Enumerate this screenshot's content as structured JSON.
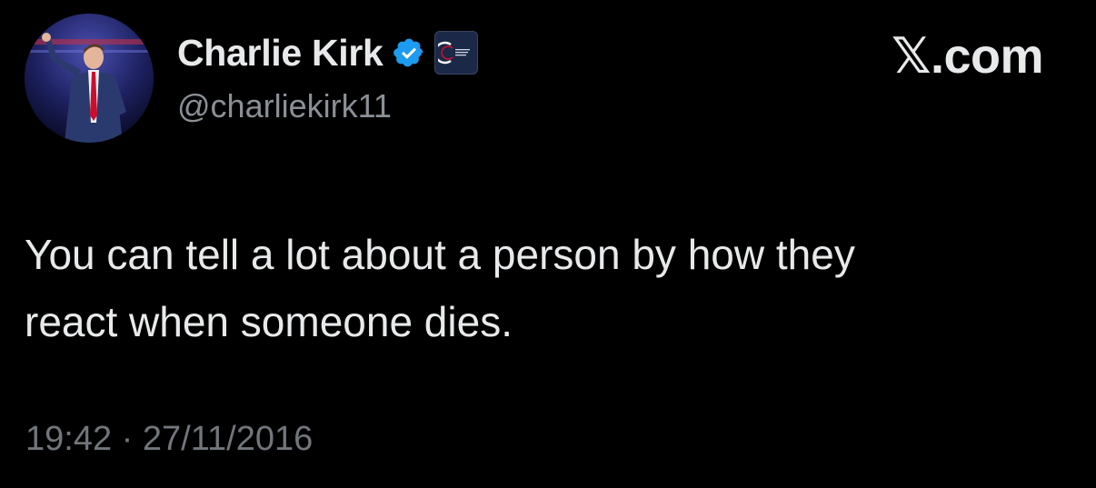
{
  "author": {
    "display_name": "Charlie Kirk",
    "handle": "@charliekirk11",
    "avatar_icon": "profile-photo",
    "verified_icon": "verified-badge-icon",
    "verified_color": "#1d9bf0",
    "affiliate_icon": "turning-point-usa-badge-icon"
  },
  "site": {
    "logo_text": "𝕏.com"
  },
  "tweet": {
    "text": "You can tell a lot about a person by how they\nreact when someone dies.",
    "timestamp": "19:42 · 27/11/2016"
  },
  "colors": {
    "background": "#000000",
    "primary_text": "#e7e9ea",
    "secondary_text": "#71767b"
  }
}
